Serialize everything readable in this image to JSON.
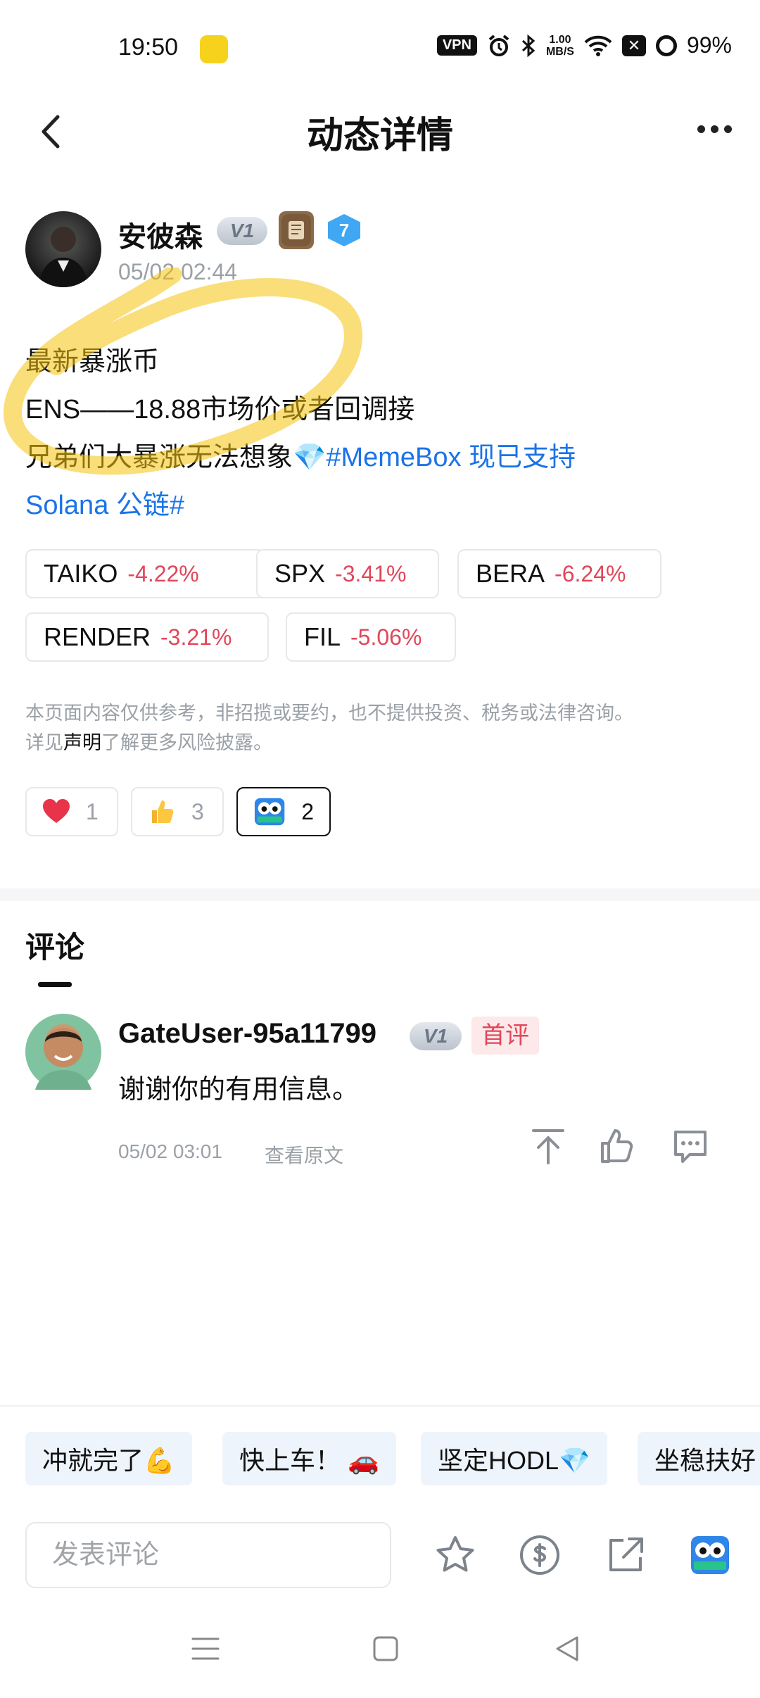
{
  "status": {
    "time": "19:50",
    "vpn": "VPN",
    "speed_value": "1.00",
    "speed_unit": "MB/S",
    "battery": "99%"
  },
  "header": {
    "title": "动态详情"
  },
  "post": {
    "author": "安彼森",
    "badge_level": "V1",
    "badge_number": "7",
    "time": "05/02 02:44",
    "lines": [
      "最新暴涨币",
      "ENS——18.88市场价或者回调接",
      "兄弟们大暴涨无法想象💎"
    ],
    "hashtag_part1": "#MemeBox 现已支持",
    "hashtag_part2": "Solana 公链#"
  },
  "tickers": [
    {
      "symbol": "TAIKO",
      "change": "-4.22%"
    },
    {
      "symbol": "SPX",
      "change": "-3.41%"
    },
    {
      "symbol": "BERA",
      "change": "-6.24%"
    },
    {
      "symbol": "RENDER",
      "change": "-3.21%"
    },
    {
      "symbol": "FIL",
      "change": "-5.06%"
    }
  ],
  "disclaimer": {
    "line1": "本页面内容仅供参考，非招揽或要约，也不提供投资、税务或法律咨询。",
    "prefix": "详见",
    "link": "声明",
    "suffix": "了解更多风险披露。"
  },
  "reactions": [
    {
      "icon": "heart",
      "count": "1"
    },
    {
      "icon": "thumbs-up",
      "count": "3"
    },
    {
      "icon": "hodl-owl",
      "count": "2"
    }
  ],
  "comments": {
    "title": "评论",
    "items": [
      {
        "user": "GateUser-95a11799",
        "badge": "V1",
        "tag": "首评",
        "text": "谢谢你的有用信息。",
        "time": "05/02 03:01",
        "original_link": "查看原文"
      }
    ]
  },
  "quick_replies": [
    "冲就完了💪",
    "快上车！ 🚗",
    "坚定HODL💎",
    "坐稳扶好"
  ],
  "bottom_bar": {
    "input_placeholder": "发表评论"
  },
  "colors": {
    "negative": "#e0475a",
    "link": "#1a73e8",
    "muted": "#9aa0a6",
    "chip_bg": "#eef4fb"
  }
}
